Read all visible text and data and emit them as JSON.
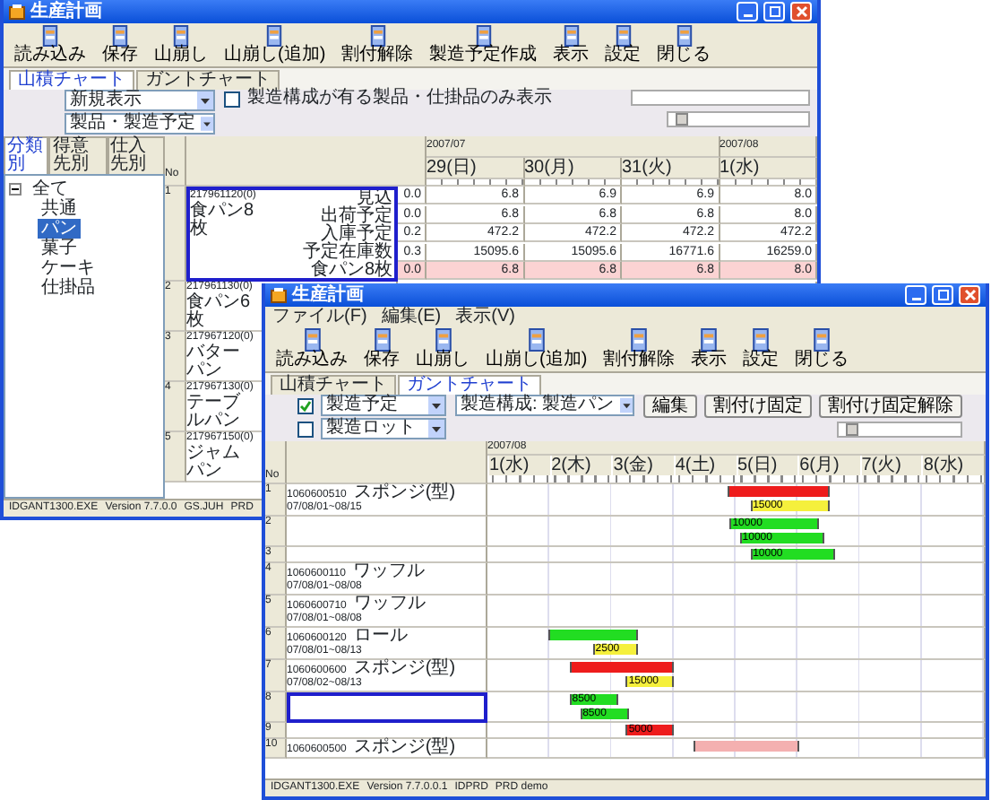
{
  "windows": [
    {
      "kind": "planner",
      "title": "生産計画",
      "toolbar": [
        "読み込み",
        "保存",
        "山崩し",
        "山崩し(追加)",
        "割付解除",
        "製造予定作成",
        "表示",
        "設定",
        "閉じる"
      ],
      "tabs": [
        {
          "label": "山積チャート",
          "selected": true
        },
        {
          "label": "ガントチャート",
          "selected": false
        }
      ],
      "filters": {
        "dropdowns": [
          "新規表示",
          "製品・製造予定"
        ],
        "checkbox": {
          "label": "製造構成が有る製品・仕掛品のみ表示",
          "checked": false
        }
      },
      "side_tabs": [
        {
          "label": "分類別",
          "selected": true
        },
        {
          "label": "得意先別",
          "selected": false
        },
        {
          "label": "仕入先別",
          "selected": false
        }
      ],
      "tree": {
        "label": "全て",
        "expanded": true,
        "selected": false,
        "children": [
          {
            "label": "共通",
            "selected": false
          },
          {
            "label": "パン",
            "selected": true
          },
          {
            "label": "菓子",
            "selected": false
          },
          {
            "label": "ケーキ",
            "selected": false
          },
          {
            "label": "仕掛品",
            "selected": false
          }
        ]
      },
      "grid": {
        "no_header": "No",
        "months": [
          {
            "label": "2007/07",
            "days": [
              "29(日)",
              "30(月)",
              "31(火)"
            ]
          },
          {
            "label": "2007/08",
            "days": [
              "1(水)"
            ]
          }
        ],
        "rows": [
          {
            "no": "1",
            "code": "217961120(0)",
            "name": "食パン8枚",
            "selected": true,
            "lines": [
              {
                "label": "見込",
                "first": "0.0",
                "values": [
                  "6.8",
                  "6.9",
                  "6.9",
                  "8.0"
                ],
                "highlight": false
              },
              {
                "label": "出荷予定",
                "first": "0.0",
                "values": [
                  "6.8",
                  "6.8",
                  "6.8",
                  "8.0"
                ],
                "highlight": false
              },
              {
                "label": "入庫予定",
                "first": "0.2",
                "values": [
                  "472.2",
                  "472.2",
                  "472.2",
                  "472.2"
                ],
                "highlight": false
              },
              {
                "label": "予定在庫数",
                "first": "0.3",
                "values": [
                  "15095.6",
                  "15095.6",
                  "16771.6",
                  "16259.0"
                ],
                "highlight": false
              },
              {
                "label": "食パン8枚",
                "first": "0.0",
                "values": [
                  "6.8",
                  "6.8",
                  "6.8",
                  "8.0"
                ],
                "highlight": true
              }
            ]
          },
          {
            "no": "2",
            "code": "217961130(0)",
            "name": "食パン6枚",
            "selected": false,
            "lines": []
          },
          {
            "no": "3",
            "code": "217967120(0)",
            "name": "バターパン",
            "selected": false,
            "lines": []
          },
          {
            "no": "4",
            "code": "217967130(0)",
            "name": "テーブルパン",
            "selected": false,
            "lines": []
          },
          {
            "no": "5",
            "code": "217967150(0)",
            "name": "ジャムパン",
            "selected": false,
            "lines": []
          }
        ]
      },
      "status_bar": [
        "IDGANT1300.EXE",
        "Version 7.7.0.0",
        "GS.JUH",
        "PRD"
      ]
    },
    {
      "kind": "gantt",
      "title": "生産計画",
      "menu": [
        "ファイル(F)",
        "編集(E)",
        "表示(V)"
      ],
      "toolbar": [
        "読み込み",
        "保存",
        "山崩し",
        "山崩し(追加)",
        "割付解除",
        "表示",
        "設定",
        "閉じる"
      ],
      "tabs": [
        {
          "label": "山積チャート",
          "selected": false
        },
        {
          "label": "ガントチャート",
          "selected": true
        }
      ],
      "filters": {
        "checks": [
          {
            "label": "製造予定",
            "checked": true
          },
          {
            "label": "製造ロット",
            "checked": false
          }
        ],
        "structure": "製造構成: 製造パン",
        "buttons": [
          "編集",
          "割付け固定",
          "割付け固定解除"
        ]
      },
      "gantt": {
        "no_header": "No",
        "month": "2007/08",
        "days": [
          "1(水)",
          "2(木)",
          "3(金)",
          "4(土)",
          "5(日)",
          "6(月)",
          "7(火)",
          "8(水)"
        ],
        "rows": [
          {
            "no": "1",
            "code": "1060600510",
            "name": "スポンジ(型)",
            "period": "07/08/01~08/15",
            "selected": false,
            "bars": [
              {
                "color": "#ee1c1c",
                "start": {
                  "level": 0.484
                },
                "end": {
                  "level": 0.687
                }
              },
              {
                "color": "#f5f03c",
                "start": {
                  "level": 0.531
                },
                "end": {
                  "level": 0.687
                },
                "label": "15000"
              }
            ]
          },
          {
            "no": "2",
            "selected": false,
            "bars": [
              {
                "color": "#22dd22",
                "start": {
                  "level": 0.49
                },
                "end": {
                  "level": 0.667
                },
                "label": "10000"
              },
              {
                "color": "#22dd22",
                "start": {
                  "level": 0.51
                },
                "end": {
                  "level": 0.677
                },
                "label": "10000"
              }
            ]
          },
          {
            "no": "3",
            "selected": false,
            "bars": [
              {
                "color": "#22dd22",
                "start": {
                  "level": 0.531
                },
                "end": {
                  "level": 0.698
                },
                "label": "10000"
              }
            ]
          },
          {
            "no": "4",
            "code": "1060600110",
            "name": "ワッフル",
            "period": "07/08/01~08/08",
            "selected": false,
            "bars": []
          },
          {
            "no": "5",
            "code": "1060600710",
            "name": "ワッフル",
            "period": "07/08/01~08/08",
            "selected": false,
            "bars": []
          },
          {
            "no": "6",
            "code": "1060600120",
            "name": "ロール",
            "period": "07/08/01~08/13",
            "selected": false,
            "bars": [
              {
                "color": "#22dd22",
                "start": {
                  "level": 0.125
                },
                "end": {
                  "level": 0.302
                }
              },
              {
                "color": "#f5f03c",
                "start": {
                  "level": 0.214
                },
                "end": {
                  "level": 0.303
                },
                "label": "2500"
              }
            ]
          },
          {
            "no": "7",
            "code": "1060600600",
            "name": "スポンジ(型)",
            "period": "07/08/02~08/13",
            "selected": false,
            "bars": [
              {
                "color": "#ee1c1c",
                "start": {
                  "level": 0.167
                },
                "end": {
                  "level": 0.375
                }
              },
              {
                "color": "#f5f03c",
                "start": {
                  "level": 0.281
                },
                "end": {
                  "level": 0.375
                },
                "label": "15000"
              }
            ]
          },
          {
            "no": "8",
            "selected": true,
            "bars": [
              {
                "color": "#22dd22",
                "start": {
                  "level": 0.167
                },
                "end": {
                  "level": 0.261
                },
                "label": "8500"
              },
              {
                "color": "#22dd22",
                "start": {
                  "level": 0.188
                },
                "end": {
                  "level": 0.282
                },
                "label": "8500"
              }
            ]
          },
          {
            "no": "9",
            "selected": false,
            "bars": [
              {
                "color": "#ee1c1c",
                "start": {
                  "level": 0.281
                },
                "end": {
                  "level": 0.375
                },
                "label": "5000"
              }
            ]
          },
          {
            "no": "10",
            "code": "1060600500",
            "name": "スポンジ(型)",
            "selected": false,
            "bars": [
              {
                "color": "#f4b0b0",
                "start": {
                  "level": 0.417
                },
                "end": {
                  "level": 0.625
                }
              }
            ]
          }
        ]
      },
      "status_bar": [
        "IDGANT1300.EXE",
        "Version 7.7.0.0.1",
        "IDPRD",
        "PRD demo"
      ]
    }
  ]
}
